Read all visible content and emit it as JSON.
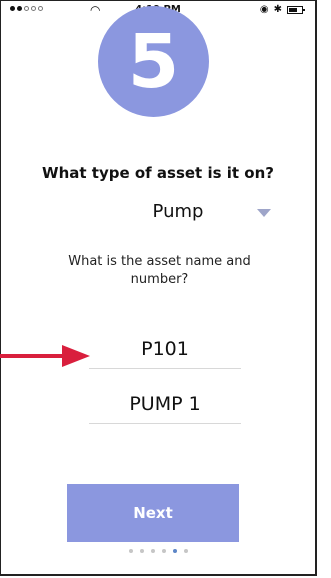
{
  "status_bar": {
    "time": "4:19 PM"
  },
  "step": {
    "number": "5"
  },
  "asset_type": {
    "question": "What type of asset is it on?",
    "selected": "Pump"
  },
  "asset_name": {
    "label": "What is the asset name and number?",
    "number_value": "P101",
    "name_value": "PUMP 1"
  },
  "actions": {
    "next_label": "Next"
  },
  "pagination": {
    "total": 6,
    "current": 5
  },
  "colors": {
    "accent": "#8b97df",
    "annotation_arrow": "#d91f3d",
    "active_dot": "#5d86c7"
  }
}
